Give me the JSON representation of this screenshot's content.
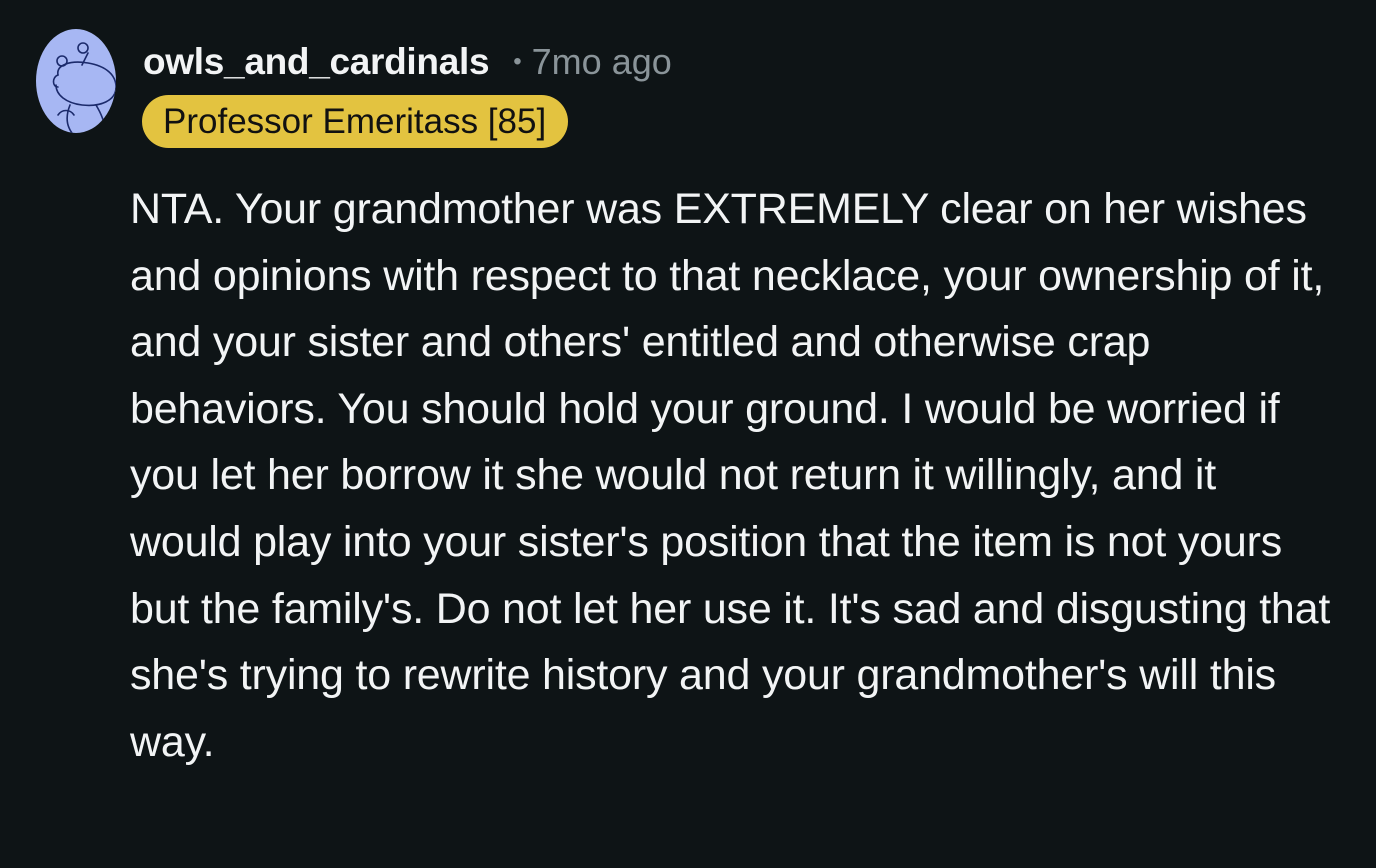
{
  "comment": {
    "author": "owls_and_cardinals",
    "separator": "•",
    "timestamp": "7mo ago",
    "flair": "Professor Emeritass [85]",
    "avatar_icon": "snoo-avatar-icon",
    "body": "NTA. Your grandmother was EXTREMELY clear on her wishes and opinions with respect to that necklace, your ownership of it, and your sister and others' entitled and otherwise crap behaviors. You should hold your ground. I would be worried if you let her borrow it she would not return it willingly, and it would play into your sister's position that the item is not yours but the family's. Do not let her use it. It's sad and disgusting that she's trying to rewrite history and your grandmother's will this way."
  },
  "colors": {
    "background": "#0e1416",
    "text": "#f2f4f5",
    "muted": "#8a9499",
    "flair_bg": "#e3c340",
    "flair_text": "#111111",
    "avatar_bg": "#a7b7f3",
    "avatar_stroke": "#1b2a6b"
  }
}
